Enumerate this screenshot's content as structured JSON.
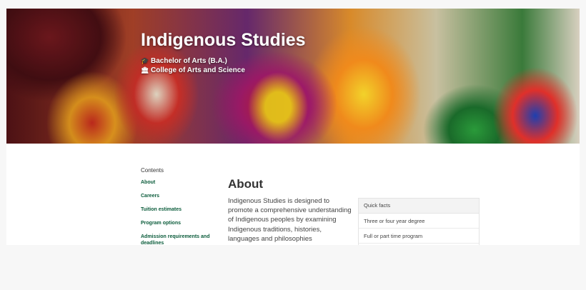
{
  "hero": {
    "title": "Indigenous Studies",
    "degree_icon": "graduation-cap-icon",
    "degree": "Bachelor of Arts (B.A.)",
    "college_icon": "institution-icon",
    "college": "College of Arts and Science"
  },
  "toc": {
    "title": "Contents",
    "links": [
      "About",
      "Careers",
      "Tuition estimates",
      "Program options",
      "Admission requirements and deadlines"
    ]
  },
  "about": {
    "heading": "About",
    "text": "Indigenous Studies is designed to promote a comprehensive understanding of Indigenous peoples by examining Indigenous traditions, histories, languages and philosophies"
  },
  "quick_facts": {
    "title": "Quick facts",
    "items": [
      "Three or four year degree",
      "Full or part time program"
    ]
  },
  "colors": {
    "link_green": "#0b5c3b",
    "page_bg": "#f7f7f7"
  }
}
